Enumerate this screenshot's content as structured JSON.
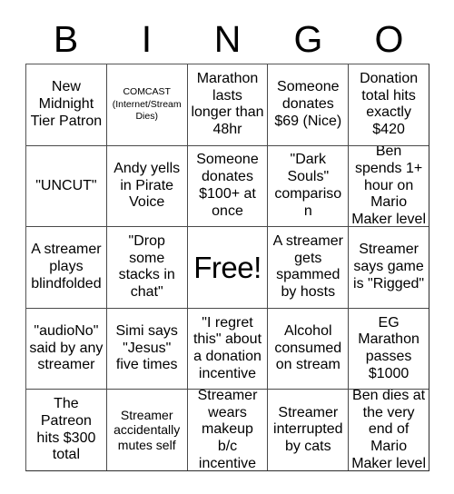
{
  "card": {
    "title_letters": [
      "B",
      "I",
      "N",
      "G",
      "O"
    ],
    "rows": [
      [
        {
          "text": "New Midnight Tier Patron",
          "size": "normal"
        },
        {
          "text": "COMCAST (Internet/Stream Dies)",
          "size": "tiny"
        },
        {
          "text": "Marathon lasts longer than 48hr",
          "size": "normal"
        },
        {
          "text": "Someone donates $69 (Nice)",
          "size": "normal"
        },
        {
          "text": "Donation total hits exactly $420",
          "size": "normal"
        }
      ],
      [
        {
          "text": "\"UNCUT\"",
          "size": "normal"
        },
        {
          "text": "Andy yells in Pirate Voice",
          "size": "normal"
        },
        {
          "text": "Someone donates $100+ at once",
          "size": "normal"
        },
        {
          "text": "\"Dark Souls\" comparison",
          "size": "normal"
        },
        {
          "text": "Ben spends 1+ hour on Mario Maker level",
          "size": "normal"
        }
      ],
      [
        {
          "text": "A streamer plays blindfolded",
          "size": "normal"
        },
        {
          "text": "\"Drop some stacks in chat\"",
          "size": "normal"
        },
        {
          "text": "Free!",
          "size": "free"
        },
        {
          "text": "A streamer gets spammed by hosts",
          "size": "normal"
        },
        {
          "text": "Streamer says game is \"Rigged\"",
          "size": "normal"
        }
      ],
      [
        {
          "text": "\"audioNo\" said by any streamer",
          "size": "normal"
        },
        {
          "text": "Simi says \"Jesus\" five times",
          "size": "normal"
        },
        {
          "text": "\"I regret this\" about a donation incentive",
          "size": "normal"
        },
        {
          "text": "Alcohol consumed on stream",
          "size": "normal"
        },
        {
          "text": "EG Marathon passes $1000",
          "size": "normal"
        }
      ],
      [
        {
          "text": "The Patreon hits $300 total",
          "size": "normal"
        },
        {
          "text": "Streamer accidentally mutes self",
          "size": "small"
        },
        {
          "text": "Streamer wears makeup b/c incentive",
          "size": "normal"
        },
        {
          "text": "Streamer interrupted by cats",
          "size": "normal"
        },
        {
          "text": "Ben dies at the very end of Mario Maker level",
          "size": "normal"
        }
      ]
    ],
    "colors": {
      "background": "#ffffff",
      "text": "#000000",
      "grid_line": "#4a4a4a",
      "grid_border": "#2b2b2b"
    }
  }
}
